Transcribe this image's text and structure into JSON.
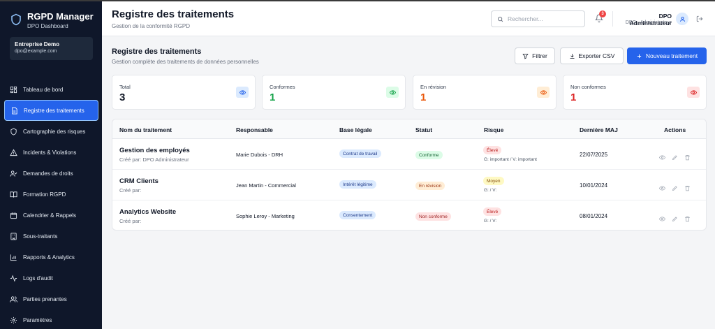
{
  "app": {
    "title": "RGPD Manager",
    "subtitle": "DPO Dashboard",
    "org_name": "Entreprise Demo",
    "org_email": "dpo@example.com"
  },
  "sidebar": {
    "items": [
      {
        "label": "Tableau de bord",
        "icon": "dashboard-icon",
        "active": false
      },
      {
        "label": "Registre des traitements",
        "icon": "document-icon",
        "active": true
      },
      {
        "label": "Cartographie des risques",
        "icon": "shield-icon",
        "active": false
      },
      {
        "label": "Incidents & Violations",
        "icon": "warning-icon",
        "active": false
      },
      {
        "label": "Demandes de droits",
        "icon": "user-check-icon",
        "active": false
      },
      {
        "label": "Formation RGPD",
        "icon": "book-icon",
        "active": false
      },
      {
        "label": "Calendrier & Rappels",
        "icon": "calendar-icon",
        "active": false
      },
      {
        "label": "Sous-traitants",
        "icon": "building-icon",
        "active": false
      },
      {
        "label": "Rapports & Analytics",
        "icon": "chart-icon",
        "active": false
      },
      {
        "label": "Logs d'audit",
        "icon": "activity-icon",
        "active": false
      },
      {
        "label": "Parties prenantes",
        "icon": "users-icon",
        "active": false
      },
      {
        "label": "Paramètres",
        "icon": "gear-icon",
        "active": false
      }
    ]
  },
  "header": {
    "title": "Registre des traitements",
    "subtitle": "Gestion de la conformité RGPD",
    "search_placeholder": "Rechercher...",
    "notification_count": "3",
    "user_name": "DPO Administrateur",
    "user_role": "DPO - Administrateur"
  },
  "section": {
    "title": "Registre des traitements",
    "subtitle": "Gestion complète des traitements de données personnelles",
    "filter_label": "Filtrer",
    "export_label": "Exporter CSV",
    "new_label": "Nouveau traitement"
  },
  "stats": [
    {
      "label": "Total",
      "value": "3",
      "value_color": "#111827",
      "icon_bg": "#dbeafe",
      "icon_color": "#2563eb"
    },
    {
      "label": "Conformes",
      "value": "1",
      "value_color": "#16a34a",
      "icon_bg": "#dcfce7",
      "icon_color": "#16a34a"
    },
    {
      "label": "En révision",
      "value": "1",
      "value_color": "#ea580c",
      "icon_bg": "#ffedd5",
      "icon_color": "#ea580c"
    },
    {
      "label": "Non conformes",
      "value": "1",
      "value_color": "#dc2626",
      "icon_bg": "#fee2e2",
      "icon_color": "#dc2626"
    }
  ],
  "table": {
    "columns": [
      "Nom du traitement",
      "Responsable",
      "Base légale",
      "Statut",
      "Risque",
      "Dernière MAJ",
      "Actions"
    ],
    "rows": [
      {
        "name": "Gestion des employés",
        "creator": "Créé par: DPO Administrateur",
        "responsible": "Marie Dubois - DRH",
        "legal_basis": "Contrat de travail",
        "status": "Conforme",
        "risk": "Élevé",
        "gv": "G: important / V: important",
        "updated": "22/07/2025"
      },
      {
        "name": "CRM Clients",
        "creator": "Créé par:",
        "responsible": "Jean Martin - Commercial",
        "legal_basis": "Intérêt légitime",
        "status": "En révision",
        "risk": "Moyen",
        "gv": "G: / V:",
        "updated": "10/01/2024"
      },
      {
        "name": "Analytics Website",
        "creator": "Créé par:",
        "responsible": "Sophie Leroy - Marketing",
        "legal_basis": "Consentement",
        "status": "Non conforme",
        "risk": "Élevé",
        "gv": "G: / V:",
        "updated": "08/01/2024"
      }
    ]
  }
}
